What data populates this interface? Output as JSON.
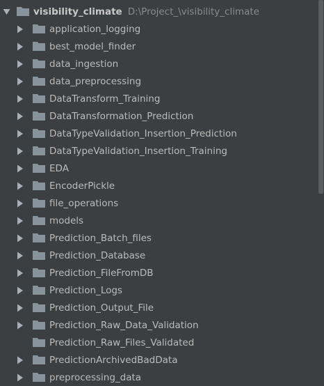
{
  "root": {
    "name": "visibility_climate",
    "path": "D:\\Project_\\visibility_climate"
  },
  "items": [
    {
      "label": "application_logging",
      "expandable": true
    },
    {
      "label": "best_model_finder",
      "expandable": true
    },
    {
      "label": "data_ingestion",
      "expandable": true
    },
    {
      "label": "data_preprocessing",
      "expandable": true
    },
    {
      "label": "DataTransform_Training",
      "expandable": true
    },
    {
      "label": "DataTransformation_Prediction",
      "expandable": true
    },
    {
      "label": "DataTypeValidation_Insertion_Prediction",
      "expandable": true
    },
    {
      "label": "DataTypeValidation_Insertion_Training",
      "expandable": true
    },
    {
      "label": "EDA",
      "expandable": true
    },
    {
      "label": "EncoderPickle",
      "expandable": true
    },
    {
      "label": "file_operations",
      "expandable": true
    },
    {
      "label": "models",
      "expandable": true
    },
    {
      "label": "Prediction_Batch_files",
      "expandable": true
    },
    {
      "label": "Prediction_Database",
      "expandable": true
    },
    {
      "label": "Prediction_FileFromDB",
      "expandable": true
    },
    {
      "label": "Prediction_Logs",
      "expandable": true
    },
    {
      "label": "Prediction_Output_File",
      "expandable": true
    },
    {
      "label": "Prediction_Raw_Data_Validation",
      "expandable": true
    },
    {
      "label": "Prediction_Raw_Files_Validated",
      "expandable": false
    },
    {
      "label": "PredictionArchivedBadData",
      "expandable": true
    },
    {
      "label": "preprocessing_data",
      "expandable": true
    }
  ],
  "colors": {
    "background": "#3c3f41",
    "text": "#bbbbbb",
    "path_text": "#8a8a8a",
    "folder": "#87939a",
    "arrow": "#a9b0b5",
    "scroll_thumb": "#5b5e60"
  },
  "icons": {
    "expanded": "triangle-down-icon",
    "collapsed": "triangle-right-icon",
    "folder": "folder-icon"
  }
}
